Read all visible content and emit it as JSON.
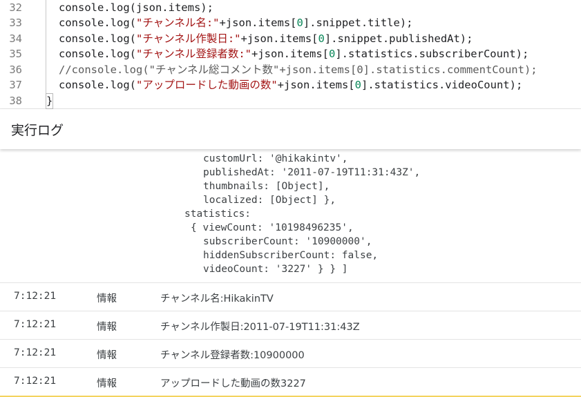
{
  "editor": {
    "closing_brace": "}",
    "lines": [
      {
        "num": "32",
        "parts": [
          [
            "code",
            "console.log(json.items);"
          ]
        ]
      },
      {
        "num": "33",
        "parts": [
          [
            "code",
            "console.log("
          ],
          [
            "str",
            "\"チャンネル名:\""
          ],
          [
            "code",
            "+json.items["
          ],
          [
            "num",
            "0"
          ],
          [
            "code",
            "].snippet.title);"
          ]
        ]
      },
      {
        "num": "34",
        "parts": [
          [
            "code",
            "console.log("
          ],
          [
            "str",
            "\"チャンネル作製日:\""
          ],
          [
            "code",
            "+json.items["
          ],
          [
            "num",
            "0"
          ],
          [
            "code",
            "].snippet.publishedAt);"
          ]
        ]
      },
      {
        "num": "35",
        "parts": [
          [
            "code",
            "console.log("
          ],
          [
            "str",
            "\"チャンネル登録者数:\""
          ],
          [
            "code",
            "+json.items["
          ],
          [
            "num",
            "0"
          ],
          [
            "code",
            "].statistics.subscriberCount);"
          ]
        ]
      },
      {
        "num": "36",
        "parts": [
          [
            "comment",
            "//console.log(\"チャンネル総コメント数\"+json.items[0].statistics.commentCount);"
          ]
        ]
      },
      {
        "num": "37",
        "parts": [
          [
            "code",
            "console.log("
          ],
          [
            "str",
            "\"アップロードした動画の数\""
          ],
          [
            "code",
            "+json.items["
          ],
          [
            "num",
            "0"
          ],
          [
            "code",
            "].statistics.videoCount);"
          ]
        ]
      },
      {
        "num": "38",
        "parts": []
      }
    ]
  },
  "log_header": {
    "title": "実行ログ"
  },
  "log_output": {
    "json_lines": [
      {
        "indent": 294,
        "text": "customUrl: '@hikakintv',"
      },
      {
        "indent": 294,
        "text": "publishedAt: '2011-07-19T11:31:43Z',"
      },
      {
        "indent": 294,
        "text": "thumbnails: [Object],"
      },
      {
        "indent": 294,
        "text": "localized: [Object] },"
      },
      {
        "indent": 267,
        "text": "statistics:"
      },
      {
        "indent": 276,
        "text": "{ viewCount: '10198496235',"
      },
      {
        "indent": 294,
        "text": "subscriberCount: '10900000',"
      },
      {
        "indent": 294,
        "text": "hiddenSubscriberCount: false,"
      },
      {
        "indent": 294,
        "text": "videoCount: '3227' } } ]"
      }
    ],
    "entries": [
      {
        "time": "7:12:21",
        "level": "情報",
        "message": "チャンネル名:HikakinTV"
      },
      {
        "time": "7:12:21",
        "level": "情報",
        "message": "チャンネル作製日:2011-07-19T11:31:43Z"
      },
      {
        "time": "7:12:21",
        "level": "情報",
        "message": "チャンネル登録者数:10900000"
      },
      {
        "time": "7:12:21",
        "level": "情報",
        "message": "アップロードした動画の数3227"
      }
    ]
  },
  "colors": {
    "string": "#a31515",
    "number": "#098658",
    "accent_bottom": "#f4d35e"
  }
}
